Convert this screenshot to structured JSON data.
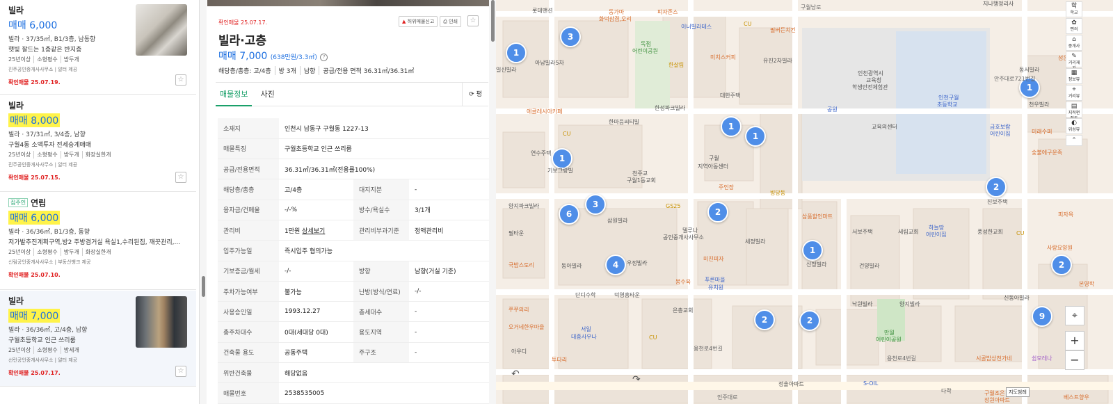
{
  "listings": [
    {
      "type": "빌라",
      "price": "매매 6,000",
      "spec": "빌라 · 37/35㎡, B1/3층, 남동향",
      "desc": "햇빛 잘드는 1층같은 반지층",
      "tags": [
        "25년이상",
        "소형평수",
        "방두개"
      ],
      "agent": "진주공인중개사사무소 | 알터 제공",
      "confirmed": "확인매물 25.07.19."
    },
    {
      "type": "빌라",
      "price": "매매 8,000",
      "spec": "빌라 · 37/31㎡, 3/4층, 남향",
      "desc": "구월4동 소액투자 전세승계매매",
      "tags": [
        "25년이상",
        "소형평수",
        "방두개",
        "화장실한개"
      ],
      "agent": "진주공인중개사사무소 | 알터 제공",
      "confirmed": "확인매물 25.07.15."
    },
    {
      "badge": "집주인",
      "type": "연립",
      "price": "매매 6,000",
      "spec": "빌라 · 36/36㎡, B1/3층, 동향",
      "desc": "저가발추진계획구역,방2 주방겸거실 욕실1,수리된집, 깨끗관리,...",
      "tags": [
        "25년이상",
        "소형평수",
        "방두개",
        "화장실한개"
      ],
      "agent": "신림공인중개사사무소 | 부동산뱅크 제공",
      "confirmed": "확인매물 25.07.10."
    },
    {
      "type": "빌라",
      "price": "매매 7,000",
      "spec": "빌라 · 36/36㎡, 고/4층, 남향",
      "desc": "구월초등학교 인근 쓰리룸",
      "tags": [
        "25년이상",
        "소형평수",
        "방세개"
      ],
      "agent": "선린공인중개사사무소 | 알터 제공",
      "confirmed": "확인매물 25.07.17."
    }
  ],
  "detail": {
    "confirmed": "확인매물 25.07.17.",
    "report_label": "허위매물신고",
    "print_label": "인쇄",
    "title": "빌라·고층",
    "price": "매매 7,000",
    "price_unit": "(638만원/3.3㎡)",
    "summary": [
      "해당층/총층: 고/4층",
      "방 3개",
      "남향",
      "공급/전용 면적 36.31㎡/36.31㎡"
    ],
    "tabs": [
      "매물정보",
      "사진"
    ],
    "tab_right": "평",
    "info_address_label": "소재지",
    "info_address": "인천시 남동구 구월동 1227-13",
    "info_feature_label": "매물특징",
    "info_feature": "구월초등학교 인근 쓰리룸",
    "info_area_label": "공급/전용면적",
    "info_area": "36.31㎡/36.31㎡(전용률100%)",
    "rows": [
      {
        "k1": "해당층/총층",
        "v1": "고/4층",
        "k2": "대지지분",
        "v2": "-"
      },
      {
        "k1": "융자금/건폐율",
        "v1": "-/-%",
        "k2": "방수/욕실수",
        "v2": "3/1개"
      },
      {
        "k1": "관리비",
        "v1": "1만원",
        "v1_link": "상세보기",
        "k2": "관리비부과기준",
        "v2": "정액관리비"
      }
    ],
    "move_in_label": "입주가능일",
    "move_in": "즉시입주 협의가능",
    "rows2": [
      {
        "k1": "기보증금/월세",
        "v1": "-/-",
        "k2": "방향",
        "v2": "남향(거실 기준)"
      },
      {
        "k1": "주차가능여부",
        "v1": "불가능",
        "k2": "난방(방식/연료)",
        "v2": "-/-"
      },
      {
        "k1": "사용승인일",
        "v1": "1993.12.27",
        "k2": "총세대수",
        "v2": "-"
      },
      {
        "k1": "총주차대수",
        "v1": "0대(세대당 0대)",
        "k2": "용도지역",
        "v2": "-"
      },
      {
        "k1": "건축물 용도",
        "v1": "공동주택",
        "k2": "주구조",
        "v2": "-"
      }
    ],
    "violation_label": "위반건축물",
    "violation": "해당없음",
    "number_label": "매물번호",
    "number": "2538535005"
  },
  "map": {
    "clusters": [
      "1",
      "3",
      "1",
      "1",
      "1",
      "2",
      "3",
      "6",
      "2",
      "1",
      "4",
      "1",
      "2",
      "2",
      "9",
      "2",
      "1"
    ],
    "labels": {
      "l1": "롯데맨션",
      "l2": "동가마",
      "l3": "화덕삼겹,오리",
      "l4": "피자존스",
      "l5": "구월남로",
      "l6": "지나행정리사",
      "l7": "이너빌라테스",
      "l8": "CU",
      "l9": "필버든치킨",
      "l10": "독점",
      "l11": "어린이공원",
      "l12": "아남빌라5차",
      "l13": "미치스커피",
      "l14": "한살림",
      "l15": "인천광역시",
      "l16": "교육청",
      "l17": "학생안전체험관",
      "l18": "인천구월",
      "l19": "초등학교",
      "l20": "안주대로721번길",
      "l21": "천우빌라",
      "l22": "유진2차빌라",
      "l23": "에클레시아카페",
      "l24": "한성파크빌라",
      "l25": "한마음씨티빌",
      "l26": "CU",
      "l27": "교육의센터",
      "l28": "대한주택",
      "l29": "구월",
      "l30": "지역아동센터",
      "l31": "천주교",
      "l32": "구월1동교회",
      "l33": "연수주택",
      "l34": "기보그랑빌",
      "l35": "주인장",
      "l36": "빙당동",
      "l37": "GS25",
      "l38": "양지파크빌라",
      "l39": "삼원빌라",
      "l40": "삼품할인마트",
      "l41": "서보주택",
      "l42": "세림교회",
      "l43": "하늘땅",
      "l44": "어린이집",
      "l45": "풍성한교회",
      "l46": "진보주택",
      "l47": "피자옥",
      "l48": "델루나",
      "l49": "공인중개사사무소",
      "l50": "세정빌라",
      "l51": "신정빌라",
      "l52": "건양빌라",
      "l53": "사랑요양원",
      "l54": "국밥스토리",
      "l55": "동아빌라",
      "l56": "우정빌라",
      "l57": "미친피자",
      "l58": "봉수육",
      "l59": "푸른마을",
      "l60": "유치원",
      "l61": "낙원빌라",
      "l62": "양지빌라",
      "l63": "신동아빌라",
      "l64": "본영학",
      "l65": "쭈쭈의리",
      "l66": "단디수학",
      "l67": "덕영흥타운",
      "l68": "은총교회",
      "l69": "만월",
      "l70": "어린이공원",
      "l71": "오거네한우마을",
      "l72": "서일",
      "l73": "대중사우나",
      "l74": "CU",
      "l75": "용천로4번길",
      "l76": "용천로4번길",
      "l77": "시골밥상천가네",
      "l78": "쉼모레나",
      "l79": "아우디",
      "l80": "투다리",
      "l81": "정솔아파트",
      "l82": "S-OIL",
      "l83": "다락",
      "l84": "구월조은",
      "l85": "장원아파트",
      "l86": "베스트향우",
      "l87": "인주대로",
      "l88": "공원",
      "l89": "금호보람",
      "l90": "어린이집",
      "l91": "미래수퍼",
      "l92": "숯불에구운족",
      "l93": "동서빌라",
      "l94": "성은",
      "l95": "일신빌라",
      "l96": "필타운",
      "l97": "CU",
      "l98": "CU"
    },
    "tools": [
      {
        "icon": "학",
        "label": "학교"
      },
      {
        "icon": "✿",
        "label": "편의"
      },
      {
        "icon": "⌂",
        "label": "중개사"
      },
      {
        "icon": "✎",
        "label": "거리재기"
      },
      {
        "icon": "▦",
        "label": "정보뷰"
      },
      {
        "icon": "⌖",
        "label": "거리뷰"
      },
      {
        "icon": "▤",
        "label": "지적편집도"
      },
      {
        "icon": "◐",
        "label": "위성뷰"
      }
    ],
    "scale": "지도범례"
  }
}
